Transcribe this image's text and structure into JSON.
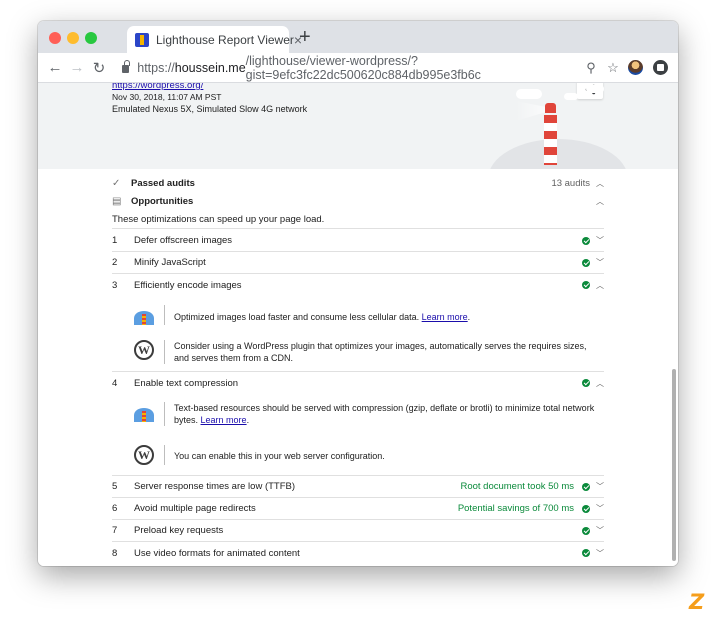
{
  "browser": {
    "tab_title": "Lighthouse Report Viewer",
    "tab_close": "×",
    "new_tab": "+",
    "url_scheme": "https://",
    "url_host": "houssein.me",
    "url_path": "/lighthouse/viewer-wordpress/?gist=9efc3fc22dc500620c884db995e3fb6c"
  },
  "icons": {
    "back": "←",
    "forward": "→",
    "reload": "↻",
    "zoom": "⚲",
    "star": "☆",
    "share": "⋖",
    "check": "✓",
    "chevron_up": "︿",
    "chevron_down": "﹀",
    "opportunity": "▤"
  },
  "report": {
    "site_link": "https://wordpress.org/",
    "date": "Nov 30, 2018, 11:07 AM PST",
    "emulation": "Emulated Nexus 5X, Simulated Slow 4G network"
  },
  "passed": {
    "label": "Passed audits",
    "count": "13 audits"
  },
  "opportunities": {
    "label": "Opportunities",
    "description": "These optimizations can speed up your page load."
  },
  "audits": [
    {
      "num": "1",
      "title": "Defer offscreen images",
      "metric": ""
    },
    {
      "num": "2",
      "title": "Minify JavaScript",
      "metric": ""
    },
    {
      "num": "3",
      "title": "Efficiently encode images",
      "metric": ""
    },
    {
      "num": "4",
      "title": "Enable text compression",
      "metric": ""
    },
    {
      "num": "5",
      "title": "Server response times are low (TTFB)",
      "metric": "Root document took 50 ms"
    },
    {
      "num": "6",
      "title": "Avoid multiple page redirects",
      "metric": "Potential savings of 700 ms"
    },
    {
      "num": "7",
      "title": "Preload key requests",
      "metric": ""
    },
    {
      "num": "8",
      "title": "Use video formats for animated content",
      "metric": ""
    }
  ],
  "details": {
    "images_lh": "Optimized images load faster and consume less cellular data.",
    "images_wp": "Consider using a WordPress plugin that optimizes your images, automatically serves the requires sizes, and serves them from a CDN.",
    "text_lh": "Text-based resources should be served with compression (gzip, deflate or brotli) to minimize total network bytes.",
    "text_wp": "You can enable this in your web server configuration.",
    "learn_more": "Learn more",
    "wp_glyph": "W"
  },
  "brand_glyph": "Z",
  "colors": {
    "pass": "#0b8a3b",
    "link": "#1a0dab",
    "lighthouse_red": "#e0453a"
  }
}
